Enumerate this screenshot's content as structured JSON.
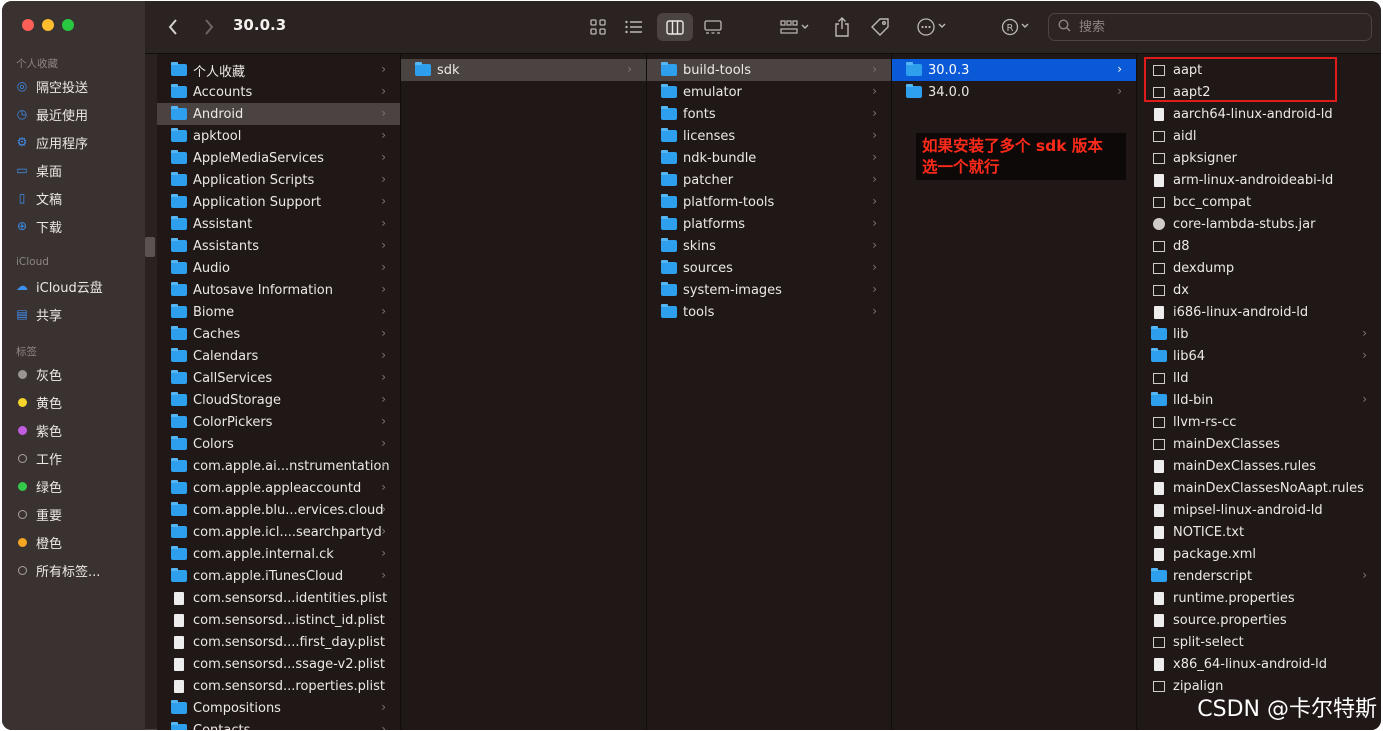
{
  "window": {
    "title": "30.0.3"
  },
  "toolbar": {
    "back_icon": "chevron-left-icon",
    "forward_icon": "chevron-right-icon",
    "view_icons": [
      "grid-view-icon",
      "list-view-icon",
      "column-view-icon",
      "gallery-view-icon"
    ],
    "group_icon": "group-icon",
    "share_icon": "share-icon",
    "tag_icon": "tag-icon",
    "more_icon": "ellipsis-icon",
    "extension_icon": "registered-icon",
    "search_placeholder": "搜索"
  },
  "sidebar": {
    "favorites_label": "个人收藏",
    "favorites": [
      {
        "label": "隔空投送",
        "icon": "airdrop-icon"
      },
      {
        "label": "最近使用",
        "icon": "clock-icon"
      },
      {
        "label": "应用程序",
        "icon": "applications-icon"
      },
      {
        "label": "桌面",
        "icon": "desktop-icon"
      },
      {
        "label": "文稿",
        "icon": "document-icon"
      },
      {
        "label": "下载",
        "icon": "download-icon"
      }
    ],
    "icloud_label": "iCloud",
    "icloud": [
      {
        "label": "iCloud云盘",
        "icon": "cloud-icon"
      },
      {
        "label": "共享",
        "icon": "shared-folder-icon"
      }
    ],
    "tags_label": "标签",
    "tags": [
      {
        "label": "灰色",
        "color": "#9a9593"
      },
      {
        "label": "黄色",
        "color": "#f4d32b"
      },
      {
        "label": "紫色",
        "color": "#c05ce0"
      },
      {
        "label": "工作",
        "color": ""
      },
      {
        "label": "绿色",
        "color": "#34c84a"
      },
      {
        "label": "重要",
        "color": ""
      },
      {
        "label": "橙色",
        "color": "#f5a623"
      },
      {
        "label": "所有标签...",
        "color": "all"
      }
    ]
  },
  "columns": {
    "col1": [
      {
        "name": "个人收藏",
        "kind": "folder"
      },
      {
        "name": "Accounts",
        "kind": "folder"
      },
      {
        "name": "Android",
        "kind": "folder",
        "selected": "gray"
      },
      {
        "name": "apktool",
        "kind": "folder"
      },
      {
        "name": "AppleMediaServices",
        "kind": "folder"
      },
      {
        "name": "Application Scripts",
        "kind": "folder"
      },
      {
        "name": "Application Support",
        "kind": "folder"
      },
      {
        "name": "Assistant",
        "kind": "folder"
      },
      {
        "name": "Assistants",
        "kind": "folder"
      },
      {
        "name": "Audio",
        "kind": "folder"
      },
      {
        "name": "Autosave Information",
        "kind": "folder"
      },
      {
        "name": "Biome",
        "kind": "folder"
      },
      {
        "name": "Caches",
        "kind": "folder"
      },
      {
        "name": "Calendars",
        "kind": "folder"
      },
      {
        "name": "CallServices",
        "kind": "folder"
      },
      {
        "name": "CloudStorage",
        "kind": "folder"
      },
      {
        "name": "ColorPickers",
        "kind": "folder"
      },
      {
        "name": "Colors",
        "kind": "folder"
      },
      {
        "name": "com.apple.ai...nstrumentation",
        "kind": "folder"
      },
      {
        "name": "com.apple.appleaccountd",
        "kind": "folder"
      },
      {
        "name": "com.apple.blu...ervices.cloud",
        "kind": "folder"
      },
      {
        "name": "com.apple.icl....searchpartyd",
        "kind": "folder"
      },
      {
        "name": "com.apple.internal.ck",
        "kind": "folder"
      },
      {
        "name": "com.apple.iTunesCloud",
        "kind": "folder"
      },
      {
        "name": "com.sensorsd...identities.plist",
        "kind": "doc"
      },
      {
        "name": "com.sensorsd...istinct_id.plist",
        "kind": "doc"
      },
      {
        "name": "com.sensorsd....first_day.plist",
        "kind": "doc"
      },
      {
        "name": "com.sensorsd...ssage-v2.plist",
        "kind": "doc"
      },
      {
        "name": "com.sensorsd...roperties.plist",
        "kind": "doc"
      },
      {
        "name": "Compositions",
        "kind": "folder"
      },
      {
        "name": "Contacts",
        "kind": "folder"
      }
    ],
    "col2": [
      {
        "name": "sdk",
        "kind": "folder",
        "selected": "gray"
      }
    ],
    "col3": [
      {
        "name": "build-tools",
        "kind": "folder",
        "selected": "gray"
      },
      {
        "name": "emulator",
        "kind": "folder"
      },
      {
        "name": "fonts",
        "kind": "folder"
      },
      {
        "name": "licenses",
        "kind": "folder"
      },
      {
        "name": "ndk-bundle",
        "kind": "folder"
      },
      {
        "name": "patcher",
        "kind": "folder"
      },
      {
        "name": "platform-tools",
        "kind": "folder"
      },
      {
        "name": "platforms",
        "kind": "folder"
      },
      {
        "name": "skins",
        "kind": "folder"
      },
      {
        "name": "sources",
        "kind": "folder"
      },
      {
        "name": "system-images",
        "kind": "folder"
      },
      {
        "name": "tools",
        "kind": "folder"
      }
    ],
    "col4": [
      {
        "name": "30.0.3",
        "kind": "folder",
        "selected": "blue"
      },
      {
        "name": "34.0.0",
        "kind": "folder"
      }
    ],
    "col5": [
      {
        "name": "aapt",
        "kind": "exec"
      },
      {
        "name": "aapt2",
        "kind": "exec"
      },
      {
        "name": "aarch64-linux-android-ld",
        "kind": "doc"
      },
      {
        "name": "aidl",
        "kind": "exec"
      },
      {
        "name": "apksigner",
        "kind": "exec"
      },
      {
        "name": "arm-linux-androideabi-ld",
        "kind": "doc"
      },
      {
        "name": "bcc_compat",
        "kind": "exec"
      },
      {
        "name": "core-lambda-stubs.jar",
        "kind": "jar"
      },
      {
        "name": "d8",
        "kind": "exec"
      },
      {
        "name": "dexdump",
        "kind": "exec"
      },
      {
        "name": "dx",
        "kind": "exec"
      },
      {
        "name": "i686-linux-android-ld",
        "kind": "doc"
      },
      {
        "name": "lib",
        "kind": "folder"
      },
      {
        "name": "lib64",
        "kind": "folder"
      },
      {
        "name": "lld",
        "kind": "exec"
      },
      {
        "name": "lld-bin",
        "kind": "folder"
      },
      {
        "name": "llvm-rs-cc",
        "kind": "exec"
      },
      {
        "name": "mainDexClasses",
        "kind": "exec"
      },
      {
        "name": "mainDexClasses.rules",
        "kind": "doc"
      },
      {
        "name": "mainDexClassesNoAapt.rules",
        "kind": "doc"
      },
      {
        "name": "mipsel-linux-android-ld",
        "kind": "doc"
      },
      {
        "name": "NOTICE.txt",
        "kind": "doc"
      },
      {
        "name": "package.xml",
        "kind": "doc"
      },
      {
        "name": "renderscript",
        "kind": "folder"
      },
      {
        "name": "runtime.properties",
        "kind": "doc"
      },
      {
        "name": "source.properties",
        "kind": "doc"
      },
      {
        "name": "split-select",
        "kind": "exec"
      },
      {
        "name": "x86_64-linux-android-ld",
        "kind": "doc"
      },
      {
        "name": "zipalign",
        "kind": "exec"
      }
    ]
  },
  "annotation": {
    "line1": "如果安装了多个 sdk 版本",
    "line2": "选一个就行",
    "color": "#ff2a1a"
  },
  "watermark": "CSDN @卡尔特斯"
}
